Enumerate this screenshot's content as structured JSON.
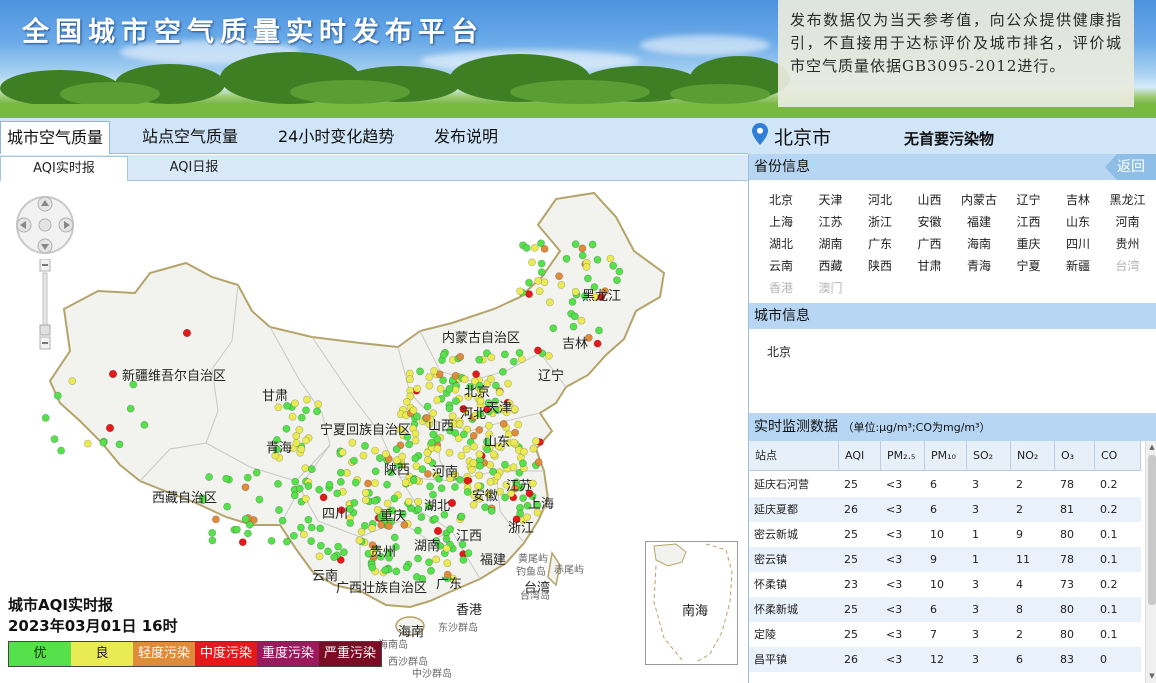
{
  "header": {
    "title": "全国城市空气质量实时发布平台",
    "notice": "发布数据仅为当天参考值，向公众提供健康指引，不直接用于达标评价及城市排名，评价城市空气质量依据GB3095-2012进行。"
  },
  "nav": {
    "tabs": [
      "城市空气质量",
      "站点空气质量",
      "24小时变化趋势",
      "发布说明"
    ],
    "active_index": 0
  },
  "location": {
    "city": "北京市",
    "primary_pollutant": "无首要污染物"
  },
  "subtabs": {
    "items": [
      "AQI实时报",
      "AQI日报"
    ],
    "active_index": 0
  },
  "map": {
    "legend_title_line1": "城市AQI实时报",
    "legend_title_line2": "2023年03月01日 16时",
    "legend": [
      {
        "label": "优",
        "color": "#55e04c"
      },
      {
        "label": "良",
        "color": "#eaea55"
      },
      {
        "label": "轻度污染",
        "color": "#df8b3c"
      },
      {
        "label": "中度污染",
        "color": "#e41919"
      },
      {
        "label": "重度污染",
        "color": "#9b1a5e"
      },
      {
        "label": "严重污染",
        "color": "#7a0c23"
      }
    ],
    "region_labels": [
      "黑龙江",
      "内蒙古自治区",
      "吉林",
      "新疆维吾尔自治区",
      "辽宁",
      "甘肃",
      "北京",
      "天津",
      "河北",
      "宁夏回族自治区",
      "山西",
      "青海",
      "山东",
      "陕西",
      "河南",
      "江苏",
      "西藏自治区",
      "安徽",
      "湖北",
      "上海",
      "四川",
      "重庆",
      "浙江",
      "江西",
      "湖南",
      "贵州",
      "福建",
      "云南",
      "广西壮族自治区",
      "广东",
      "台湾",
      "香港",
      "海南"
    ],
    "sea_labels": [
      "黄尾屿",
      "钓鱼岛",
      "赤尾屿",
      "台湾岛",
      "东沙群岛",
      "海南岛",
      "西沙群岛",
      "中沙群岛"
    ],
    "inset_label": "南海"
  },
  "province_panel": {
    "title": "省份信息",
    "back_label": "返回",
    "provinces": [
      {
        "name": "北京",
        "enabled": true
      },
      {
        "name": "天津",
        "enabled": true
      },
      {
        "name": "河北",
        "enabled": true
      },
      {
        "name": "山西",
        "enabled": true
      },
      {
        "name": "内蒙古",
        "enabled": true
      },
      {
        "name": "辽宁",
        "enabled": true
      },
      {
        "name": "吉林",
        "enabled": true
      },
      {
        "name": "黑龙江",
        "enabled": true
      },
      {
        "name": "上海",
        "enabled": true
      },
      {
        "name": "江苏",
        "enabled": true
      },
      {
        "name": "浙江",
        "enabled": true
      },
      {
        "name": "安徽",
        "enabled": true
      },
      {
        "name": "福建",
        "enabled": true
      },
      {
        "name": "江西",
        "enabled": true
      },
      {
        "name": "山东",
        "enabled": true
      },
      {
        "name": "河南",
        "enabled": true
      },
      {
        "name": "湖北",
        "enabled": true
      },
      {
        "name": "湖南",
        "enabled": true
      },
      {
        "name": "广东",
        "enabled": true
      },
      {
        "name": "广西",
        "enabled": true
      },
      {
        "name": "海南",
        "enabled": true
      },
      {
        "name": "重庆",
        "enabled": true
      },
      {
        "name": "四川",
        "enabled": true
      },
      {
        "name": "贵州",
        "enabled": true
      },
      {
        "name": "云南",
        "enabled": true
      },
      {
        "name": "西藏",
        "enabled": true
      },
      {
        "name": "陕西",
        "enabled": true
      },
      {
        "name": "甘肃",
        "enabled": true
      },
      {
        "name": "青海",
        "enabled": true
      },
      {
        "name": "宁夏",
        "enabled": true
      },
      {
        "name": "新疆",
        "enabled": true
      },
      {
        "name": "台湾",
        "enabled": false
      },
      {
        "name": "香港",
        "enabled": false
      },
      {
        "name": "澳门",
        "enabled": false
      }
    ]
  },
  "city_panel": {
    "title": "城市信息",
    "cities": [
      "北京"
    ]
  },
  "monitor": {
    "title": "实时监测数据",
    "unit_note": "（单位:μg/m³;CO为mg/m³）",
    "columns": [
      "站点",
      "AQI",
      "PM₂.₅",
      "PM₁₀",
      "SO₂",
      "NO₂",
      "O₃",
      "CO"
    ],
    "rows": [
      [
        "延庆石河营",
        "25",
        "<3",
        "6",
        "3",
        "2",
        "78",
        "0.2"
      ],
      [
        "延庆夏都",
        "26",
        "<3",
        "6",
        "3",
        "2",
        "81",
        "0.2"
      ],
      [
        "密云新城",
        "25",
        "<3",
        "10",
        "1",
        "9",
        "80",
        "0.1"
      ],
      [
        "密云镇",
        "25",
        "<3",
        "9",
        "1",
        "11",
        "78",
        "0.1"
      ],
      [
        "怀柔镇",
        "23",
        "<3",
        "10",
        "3",
        "4",
        "73",
        "0.2"
      ],
      [
        "怀柔新城",
        "25",
        "<3",
        "6",
        "3",
        "8",
        "80",
        "0.1"
      ],
      [
        "定陵",
        "25",
        "<3",
        "7",
        "3",
        "2",
        "80",
        "0.1"
      ],
      [
        "昌平镇",
        "26",
        "<3",
        "12",
        "3",
        "6",
        "83",
        "0"
      ]
    ]
  }
}
